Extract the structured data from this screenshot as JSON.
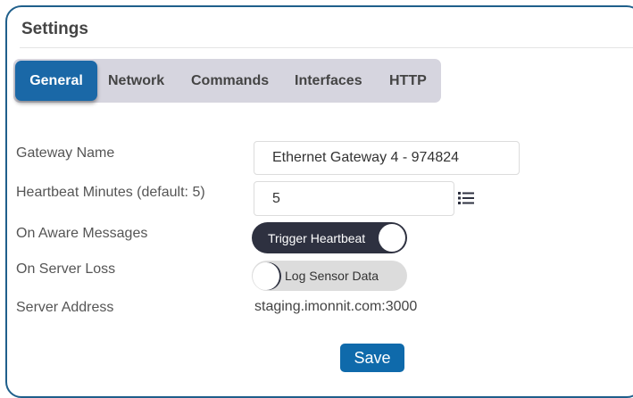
{
  "panel": {
    "title": "Settings"
  },
  "tabs": [
    {
      "label": "General",
      "active": true
    },
    {
      "label": "Network",
      "active": false
    },
    {
      "label": "Commands",
      "active": false
    },
    {
      "label": "Interfaces",
      "active": false
    },
    {
      "label": "HTTP",
      "active": false
    }
  ],
  "form": {
    "gateway_name": {
      "label": "Gateway Name",
      "value": "Ethernet Gateway 4 - 974824"
    },
    "heartbeat": {
      "label": "Heartbeat Minutes (default: 5)",
      "value": "5",
      "icon": "list-icon"
    },
    "aware_messages": {
      "label": "On Aware Messages",
      "toggle_label": "Trigger Heartbeat",
      "state": "on"
    },
    "server_loss": {
      "label": "On Server Loss",
      "toggle_label": "Log Sensor Data",
      "state": "off"
    },
    "server_address": {
      "label": "Server Address",
      "value": "staging.imonnit.com:3000"
    }
  },
  "actions": {
    "save_label": "Save"
  },
  "colors": {
    "accent": "#1a68a7",
    "panel_border": "#1f5f8b",
    "toggle_on": "#2e3140",
    "toggle_off": "#dcdcdc",
    "tabbar_bg": "#d6d5df"
  }
}
